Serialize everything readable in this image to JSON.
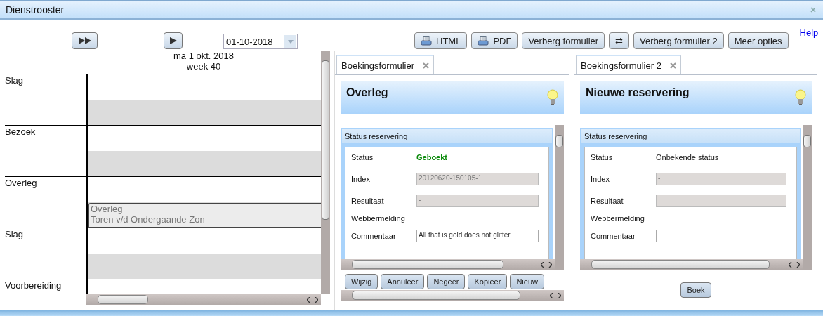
{
  "window": {
    "title": "Dienstrooster"
  },
  "schedule": {
    "nav_buttons": [
      {
        "kind": "fast-forward"
      },
      {
        "kind": "play"
      }
    ],
    "date_field": {
      "value": "01-10-2018"
    },
    "day": "ma 1 okt. 2018",
    "week": "week 40",
    "rows": [
      {
        "label": "Slag"
      },
      {
        "label": "Bezoek"
      },
      {
        "label": "Overleg",
        "event": {
          "lines": [
            "Overleg",
            "Toren v/d Ondergaande Zon"
          ]
        }
      },
      {
        "label": "Slag"
      },
      {
        "label": "Voorbereiding"
      }
    ]
  },
  "toolbar": {
    "buttons": [
      {
        "label": "HTML",
        "kind": "print"
      },
      {
        "label": "PDF",
        "kind": "print"
      },
      {
        "label": "Verberg formulier",
        "kind": "plain"
      },
      {
        "label": "⇄",
        "kind": "plain"
      },
      {
        "label": "Verberg formulier 2",
        "kind": "plain"
      },
      {
        "label": "Meer opties",
        "kind": "plain"
      }
    ],
    "help_link": "Help"
  },
  "forms": [
    {
      "tab": {
        "label": "Boekingsformulier",
        "selected": true
      },
      "title": "Overleg",
      "section_title": "Status reservering",
      "fields": [
        {
          "kind": "status",
          "label": "Status",
          "value": "Geboekt",
          "emphasis": true
        },
        {
          "kind": "readonly",
          "label": "Index",
          "value": "20120620-150105-1"
        },
        {
          "kind": "readonly",
          "label": "Resultaat",
          "value": "-"
        },
        {
          "kind": "label",
          "label": "Webbermelding"
        },
        {
          "kind": "input",
          "label": "Commentaar",
          "value": "All that is gold does not glitter"
        }
      ],
      "button_bar": {
        "kind": "scrolling",
        "buttons": [
          "Wijzig",
          "Annuleer",
          "Negeer",
          "Kopieer",
          "Nieuw"
        ]
      }
    },
    {
      "tab": {
        "label": "Boekingsformulier 2",
        "selected": true
      },
      "title": "Nieuwe reservering",
      "section_title": "Status reservering",
      "fields": [
        {
          "kind": "status",
          "label": "Status",
          "value": "Onbekende status",
          "emphasis": false
        },
        {
          "kind": "readonly",
          "label": "Index",
          "value": "-"
        },
        {
          "kind": "readonly",
          "label": "Resultaat"
        },
        {
          "kind": "label",
          "label": "Webbermelding"
        },
        {
          "kind": "input",
          "label": "Commentaar"
        }
      ],
      "button_bar": {
        "kind": "centered",
        "buttons": [
          "Boek"
        ]
      }
    }
  ]
}
